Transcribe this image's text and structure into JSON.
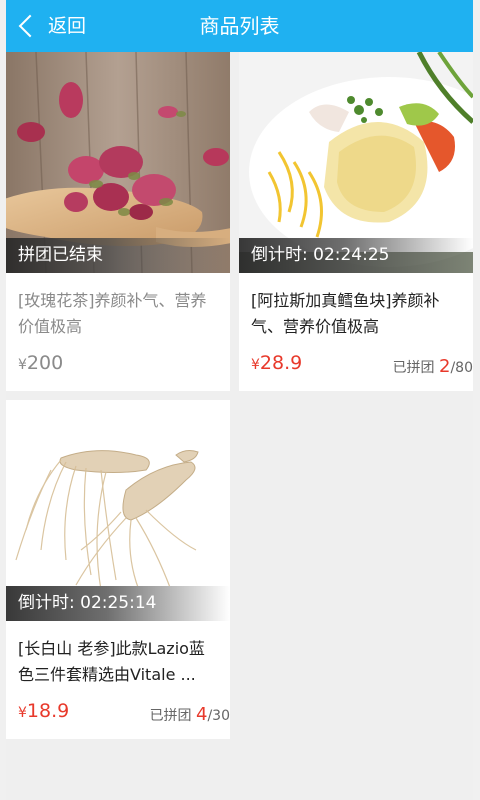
{
  "header": {
    "back_label": "返回",
    "title": "商品列表"
  },
  "colors": {
    "header_bg": "#1fb1f1",
    "price": "#e8392b",
    "count": "#e8392b"
  },
  "products": [
    {
      "image": "rose-tea-image",
      "status": "拼团已结束",
      "name": "[玫瑰花茶]养颜补气、营养价值极高",
      "currency": "¥",
      "price": "200",
      "joined_label": "",
      "joined_count": "",
      "joined_total": ""
    },
    {
      "image": "cod-fish-dish-image",
      "status": "倒计时:  02:24:25",
      "name": "[阿拉斯加真鳕鱼块]养颜补气、营养价值极高",
      "currency": "¥",
      "price": "28.9",
      "joined_label": "已拼团 ",
      "joined_count": "2",
      "joined_total": "/80"
    },
    {
      "image": "ginseng-image",
      "status": "倒计时:  02:25:14",
      "name": "[长白山 老参]此款Lazio蓝色三件套精选由Vitale ...",
      "currency": "¥",
      "price": "18.9",
      "joined_label": "已拼团 ",
      "joined_count": "4",
      "joined_total": "/30"
    }
  ]
}
